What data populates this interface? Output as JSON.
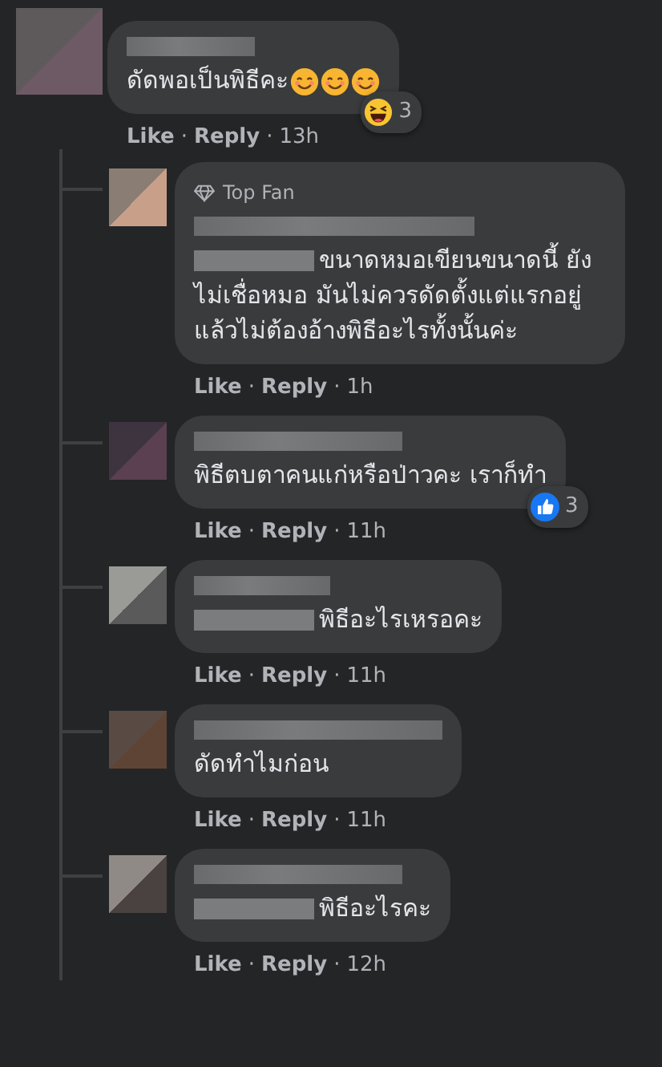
{
  "comment": {
    "text": "ดัดพอเป็นพิธีคะ",
    "emojis": [
      {
        "kind": "smile"
      },
      {
        "kind": "smile"
      },
      {
        "kind": "smile"
      }
    ],
    "reaction": {
      "kind": "haha",
      "count": "3"
    },
    "mention_redacted": false,
    "actions": [
      {
        "kind": "link",
        "text": "Like"
      },
      {
        "kind": "sep",
        "text": "·"
      },
      {
        "kind": "link",
        "text": "Reply"
      },
      {
        "kind": "sep",
        "text": "·"
      },
      {
        "kind": "time",
        "text": "13h"
      }
    ]
  },
  "replies": [
    {
      "badge": "Top Fan",
      "mention_redacted": true,
      "text": "ขนาดหมอเขียนขนาดนี้ ยังไม่เชื่อหมอ มันไม่ควรดัดตั้งแต่แรกอยู่แล้วไม่ต้องอ้างพิธีอะไรทั้งนั้นค่ะ",
      "actions": [
        {
          "kind": "link",
          "text": "Like"
        },
        {
          "kind": "sep",
          "text": "·"
        },
        {
          "kind": "link",
          "text": "Reply"
        },
        {
          "kind": "sep",
          "text": "·"
        },
        {
          "kind": "time",
          "text": "1h"
        }
      ]
    },
    {
      "mention_redacted": false,
      "text": "พิธีตบตาคนแก่หรือป่าวคะ เราก็ทำ",
      "reaction": {
        "kind": "like",
        "count": "3"
      },
      "actions": [
        {
          "kind": "link",
          "text": "Like"
        },
        {
          "kind": "sep",
          "text": "·"
        },
        {
          "kind": "link",
          "text": "Reply"
        },
        {
          "kind": "sep",
          "text": "·"
        },
        {
          "kind": "time",
          "text": "11h"
        }
      ]
    },
    {
      "mention_redacted": true,
      "text": "พิธีอะไรเหรอคะ",
      "actions": [
        {
          "kind": "link",
          "text": "Like"
        },
        {
          "kind": "sep",
          "text": "·"
        },
        {
          "kind": "link",
          "text": "Reply"
        },
        {
          "kind": "sep",
          "text": "·"
        },
        {
          "kind": "time",
          "text": "11h"
        }
      ]
    },
    {
      "mention_redacted": false,
      "text": "ดัดทำไมก่อน",
      "actions": [
        {
          "kind": "link",
          "text": "Like"
        },
        {
          "kind": "sep",
          "text": "·"
        },
        {
          "kind": "link",
          "text": "Reply"
        },
        {
          "kind": "sep",
          "text": "·"
        },
        {
          "kind": "time",
          "text": "11h"
        }
      ]
    },
    {
      "mention_redacted": true,
      "text": "พิธีอะไรคะ",
      "actions": [
        {
          "kind": "link",
          "text": "Like"
        },
        {
          "kind": "sep",
          "text": "·"
        },
        {
          "kind": "link",
          "text": "Reply"
        },
        {
          "kind": "sep",
          "text": "·"
        },
        {
          "kind": "time",
          "text": "12h"
        }
      ]
    }
  ]
}
